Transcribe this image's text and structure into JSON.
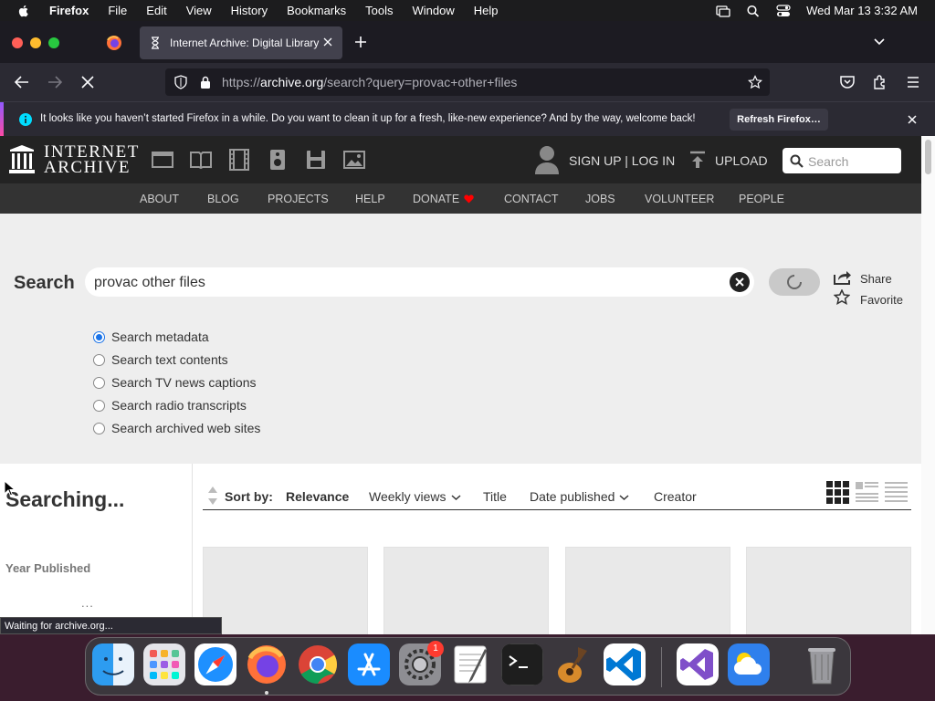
{
  "menubar": {
    "app": "Firefox",
    "items": [
      "File",
      "Edit",
      "View",
      "History",
      "Bookmarks",
      "Tools",
      "Window",
      "Help"
    ],
    "clock": "Wed Mar 13  3:32 AM"
  },
  "browser": {
    "tab_title": "Internet Archive: Digital Library",
    "url_prefix": "https://",
    "url_host": "archive.org",
    "url_path": "/search?query=provac+other+files",
    "notification": {
      "message": "It looks like you haven’t started Firefox in a while. Do you want to clean it up for a fresh, like-new experience? And by the way, welcome back!",
      "button": "Refresh Firefox…"
    },
    "status_text": "Waiting for archive.org..."
  },
  "ia": {
    "logo_line1": "INTERNET",
    "logo_line2": "ARCHIVE",
    "signup": "SIGN UP | LOG IN",
    "upload": "UPLOAD",
    "search_placeholder": "Search",
    "nav": [
      "ABOUT",
      "BLOG",
      "PROJECTS",
      "HELP",
      "DONATE",
      "CONTACT",
      "JOBS",
      "VOLUNTEER",
      "PEOPLE"
    ]
  },
  "search": {
    "label": "Search",
    "query": "provac other files",
    "share": "Share",
    "favorite": "Favorite",
    "options": [
      {
        "label": "Search metadata",
        "selected": true
      },
      {
        "label": "Search text contents",
        "selected": false
      },
      {
        "label": "Search TV news captions",
        "selected": false
      },
      {
        "label": "Search radio transcripts",
        "selected": false
      },
      {
        "label": "Search archived web sites",
        "selected": false
      }
    ]
  },
  "results": {
    "status": "Searching...",
    "facet_title": "Year Published",
    "facet_loading": "...",
    "sort_label": "Sort by:",
    "sort_options": [
      "Relevance",
      "Weekly views",
      "Title",
      "Date published",
      "Creator"
    ],
    "sort_active": "Relevance"
  },
  "dock": {
    "apps": [
      "Finder",
      "Launchpad",
      "Safari",
      "Firefox",
      "Chrome",
      "App Store",
      "System Settings",
      "TextEdit",
      "Terminal",
      "GarageBand",
      "Visual Studio Code",
      "Visual Studio",
      "Weather",
      "Trash"
    ],
    "settings_badge": "1"
  },
  "colors": {
    "accent": "#1a73e8",
    "ia_header": "#232323",
    "ia_nav": "#333333",
    "donate_heart": "#ff0000"
  }
}
